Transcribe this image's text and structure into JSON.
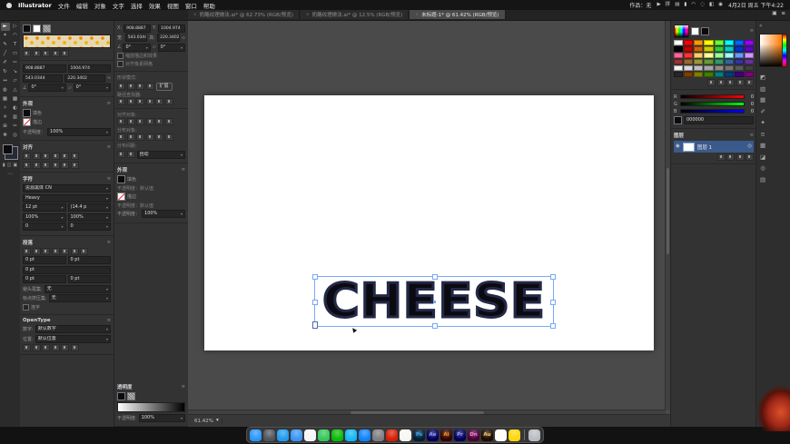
{
  "menubar": {
    "app_name": "Illustrator",
    "menus": [
      "文件",
      "编辑",
      "对象",
      "文字",
      "选择",
      "效果",
      "视图",
      "窗口",
      "帮助"
    ],
    "status_text": "作品：无",
    "icons": [
      {
        "name": "play-icon",
        "glyph": "▶"
      },
      {
        "name": "input-method-icon",
        "glyph": "拼"
      },
      {
        "name": "display-icon",
        "glyph": "▤"
      },
      {
        "name": "battery-icon",
        "glyph": "▮"
      },
      {
        "name": "wifi-icon",
        "glyph": "◠"
      },
      {
        "name": "search-icon",
        "glyph": "◌"
      },
      {
        "name": "control-center-icon",
        "glyph": "◧"
      },
      {
        "name": "siri-icon",
        "glyph": "◉"
      }
    ],
    "clock": "4月2日 周五 下午4:22"
  },
  "tabbar": {
    "tabs": [
      {
        "label": "奶酪纹理做法.ai* @ 62.73% (RGB/预览)",
        "active": false
      },
      {
        "label": "奶酪纹理做法.ai* @ 12.5% (RGB/预览)",
        "active": false
      },
      {
        "label": "未标题-1* @ 61.42% (RGB/预览)",
        "active": true
      }
    ]
  },
  "toolbar": {
    "tools": [
      {
        "name": "selection-tool",
        "glyph": "►"
      },
      {
        "name": "direct-selection-tool",
        "glyph": "▷"
      },
      {
        "name": "magic-wand-tool",
        "glyph": "✶"
      },
      {
        "name": "lasso-tool",
        "glyph": "◠"
      },
      {
        "name": "pen-tool",
        "glyph": "✎"
      },
      {
        "name": "type-tool",
        "glyph": "T"
      },
      {
        "name": "line-segment-tool",
        "glyph": "╱"
      },
      {
        "name": "rectangle-tool",
        "glyph": "▭"
      },
      {
        "name": "paintbrush-tool",
        "glyph": "✐"
      },
      {
        "name": "pencil-tool",
        "glyph": "✏"
      },
      {
        "name": "rotate-tool",
        "glyph": "↻"
      },
      {
        "name": "scale-tool",
        "glyph": "↘"
      },
      {
        "name": "width-tool",
        "glyph": "↔"
      },
      {
        "name": "free-transform-tool",
        "glyph": "▱"
      },
      {
        "name": "shape-builder-tool",
        "glyph": "◍"
      },
      {
        "name": "perspective-grid-tool",
        "glyph": "△"
      },
      {
        "name": "mesh-tool",
        "glyph": "▦"
      },
      {
        "name": "gradient-tool",
        "glyph": "▩"
      },
      {
        "name": "eyedropper-tool",
        "glyph": "✧"
      },
      {
        "name": "blend-tool",
        "glyph": "◐"
      },
      {
        "name": "symbol-sprayer-tool",
        "glyph": "✳"
      },
      {
        "name": "graph-tool",
        "glyph": "▥"
      },
      {
        "name": "artboard-tool",
        "glyph": "⊞"
      },
      {
        "name": "slice-tool",
        "glyph": "✂"
      },
      {
        "name": "hand-tool",
        "glyph": "✥"
      },
      {
        "name": "zoom-tool",
        "glyph": "◎"
      }
    ]
  },
  "brushes": {
    "icons": [
      "brush-libraries",
      "brush-strokes",
      "brush-options",
      "new-brush",
      "delete-brush"
    ]
  },
  "transform": {
    "x_label": "X:",
    "x": "908.8887",
    "y_label": "Y:",
    "y": "1004.974",
    "w_label": "宽:",
    "w": "543.0344",
    "h_label": "高:",
    "h": "220.3402",
    "rotate": "0°",
    "shear": "0°",
    "option1": "缩放描边和效果",
    "option2": "对齐像素网格"
  },
  "pathfinder": {
    "shape_modes_label": "形状模式:",
    "expand_label": "扩展",
    "pathfinders_label": "路径查找器:",
    "shape_mode_icons": [
      "unite",
      "minus-front",
      "intersect",
      "exclude"
    ],
    "pathfinder_icons": [
      "divide",
      "trim",
      "merge",
      "crop",
      "outline",
      "minus-back"
    ]
  },
  "align": {
    "title": "对齐",
    "objects_label": "对齐对象:",
    "distribute_label": "分布对象:",
    "spacing_label": "分布间距:",
    "spacing_value": "自动",
    "align_icons": [
      "align-left",
      "align-center-h",
      "align-right",
      "align-top",
      "align-middle",
      "align-bottom"
    ],
    "distribute_icons": [
      "distribute-top",
      "distribute-middle",
      "distribute-bottom",
      "distribute-left",
      "distribute-center",
      "distribute-right"
    ],
    "spacing_icons": [
      "spacing-vertical",
      "spacing-horizontal"
    ]
  },
  "appearance": {
    "title": "外观",
    "fill_label": "填色",
    "stroke_label": "描边",
    "opacity_label": "不透明度：",
    "opacity_value": "100%",
    "opacity_default_1": "不透明度：默认值",
    "opacity_default_2": "不透明度：默认值"
  },
  "character": {
    "title": "字符",
    "font_family": "思源黑体 CN",
    "font_style": "Heavy",
    "font_size": "12 pt",
    "leading": "(14.4 p",
    "kerning": "0",
    "tracking": "0",
    "v_scale": "100%",
    "h_scale": "100%"
  },
  "paragraph": {
    "title": "段落",
    "align_icons": [
      "para-align-left",
      "para-align-center",
      "para-align-right",
      "para-justify-left",
      "para-justify-center",
      "para-justify-right",
      "para-justify-all"
    ],
    "indent_left": "0 pt",
    "indent_right": "0 pt",
    "indent_first": "0 pt",
    "space_before": "0 pt",
    "space_after": "0 pt",
    "kinsoku_label": "避头尾集:",
    "kinsoku_value": "无",
    "mojikumi_label": "标点挤压集:",
    "mojikumi_value": "无",
    "hyphenate_label": "连字"
  },
  "opentype": {
    "title": "OpenType",
    "figure_label": "数字:",
    "figure_value": "默认数字",
    "position_label": "位置:",
    "position_value": "默认位置",
    "feature_icons": [
      "standard-ligatures",
      "contextual-alternates",
      "discretionary-ligatures",
      "swash",
      "stylistic-alternates",
      "titling-alternates"
    ]
  },
  "transparency": {
    "title": "透明度",
    "opacity_label": "不透明度:",
    "opacity_value": "100%"
  },
  "swatches": {
    "colors": [
      "#ffffff",
      "#ff0000",
      "#ff9900",
      "#ffff00",
      "#66ff33",
      "#00ffff",
      "#0066ff",
      "#9900ff",
      "#000000",
      "#cc0000",
      "#cc6600",
      "#cccc00",
      "#33cc33",
      "#00cccc",
      "#0033cc",
      "#6600cc",
      "#ff6699",
      "#ff3333",
      "#ffcc66",
      "#ffff99",
      "#99ff99",
      "#99ffff",
      "#6699ff",
      "#cc99ff",
      "#993333",
      "#996633",
      "#999933",
      "#669933",
      "#339966",
      "#336699",
      "#333399",
      "#663399",
      "#f2f2f2",
      "#d9d9d9",
      "#bfbfbf",
      "#a6a6a6",
      "#8c8c8c",
      "#737373",
      "#595959",
      "#404040",
      "#262626",
      "#7f3f00",
      "#7f7f00",
      "#3f7f00",
      "#007f7f",
      "#003f7f",
      "#3f007f",
      "#7f007f"
    ],
    "icons": [
      "swatch-libraries",
      "swatch-kinds",
      "swatch-options",
      "new-swatch",
      "delete-swatch"
    ]
  },
  "color": {
    "r_label": "R",
    "r_value": "0",
    "g_label": "G",
    "g_value": "0",
    "b_label": "B",
    "b_value": "0",
    "hex": "000000"
  },
  "layers": {
    "title": "图层",
    "layer_name": "图层 1",
    "icons": [
      "make-clipping-mask",
      "new-sublayer",
      "new-layer",
      "delete-layer"
    ]
  },
  "statusbar": {
    "zoom": "61.42%"
  },
  "artboard": {
    "text": "CHEESE"
  },
  "rightstrip": {
    "icons": [
      {
        "name": "color-panel",
        "glyph": "◩"
      },
      {
        "name": "color-guide-panel",
        "glyph": "▧"
      },
      {
        "name": "swatches-panel",
        "glyph": "▦"
      },
      {
        "name": "brushes-panel",
        "glyph": "✐"
      },
      {
        "name": "symbols-panel",
        "glyph": "✦"
      },
      {
        "name": "stroke-panel",
        "glyph": "≡"
      },
      {
        "name": "gradient-panel",
        "glyph": "▩"
      },
      {
        "name": "transparency-panel",
        "glyph": "◪"
      },
      {
        "name": "appearance-panel",
        "glyph": "◎"
      },
      {
        "name": "layers-panel",
        "glyph": "▤"
      }
    ]
  },
  "dock": {
    "apps": [
      {
        "id": "finder",
        "bg": "#2997ff",
        "fg": "#ffffff",
        "glyph": ""
      },
      {
        "id": "launchpad",
        "bg": "#50555c",
        "fg": "#ffffff",
        "glyph": ""
      },
      {
        "id": "safari",
        "bg": "#1f9bf0",
        "fg": "#ffffff",
        "glyph": ""
      },
      {
        "id": "mail",
        "bg": "#3a95f5",
        "fg": "#ffffff",
        "glyph": ""
      },
      {
        "id": "photos",
        "bg": "#f5f5f7",
        "fg": "#333333",
        "glyph": ""
      },
      {
        "id": "messages",
        "bg": "#34c759",
        "fg": "#ffffff",
        "glyph": ""
      },
      {
        "id": "wechat",
        "bg": "#09bb07",
        "fg": "#ffffff",
        "glyph": ""
      },
      {
        "id": "qq",
        "bg": "#12b7f5",
        "fg": "#ffffff",
        "glyph": ""
      },
      {
        "id": "app-store",
        "bg": "#0d84ff",
        "fg": "#ffffff",
        "glyph": ""
      },
      {
        "id": "system-preferences",
        "bg": "#7d7d82",
        "fg": "#ffffff",
        "glyph": ""
      },
      {
        "id": "netease-music",
        "bg": "#d81e06",
        "fg": "#ffffff",
        "glyph": ""
      },
      {
        "id": "notes",
        "bg": "#f7f7f2",
        "fg": "#333333",
        "glyph": ""
      },
      {
        "id": "photoshop",
        "bg": "#001e36",
        "fg": "#31a8ff",
        "glyph": "Ps"
      },
      {
        "id": "after-effects",
        "bg": "#00005b",
        "fg": "#9999ff",
        "glyph": "Ae"
      },
      {
        "id": "illustrator",
        "bg": "#330000",
        "fg": "#ff9a00",
        "glyph": "Ai"
      },
      {
        "id": "premiere-pro",
        "bg": "#00005b",
        "fg": "#9999ff",
        "glyph": "Pr"
      },
      {
        "id": "dimension",
        "bg": "#470137",
        "fg": "#ff7edb",
        "glyph": "Dn"
      },
      {
        "id": "audition",
        "bg": "#1d0b00",
        "fg": "#ffcf5e",
        "glyph": "Au"
      },
      {
        "id": "tencent-meeting",
        "bg": "#ffffff",
        "fg": "#2d8cff",
        "glyph": ""
      },
      {
        "id": "huorong",
        "bg": "#ffd60a",
        "fg": "#ffffff",
        "glyph": ""
      },
      {
        "id": "trash",
        "bg": "#b9bcc2",
        "fg": "#666666",
        "glyph": ""
      }
    ]
  }
}
